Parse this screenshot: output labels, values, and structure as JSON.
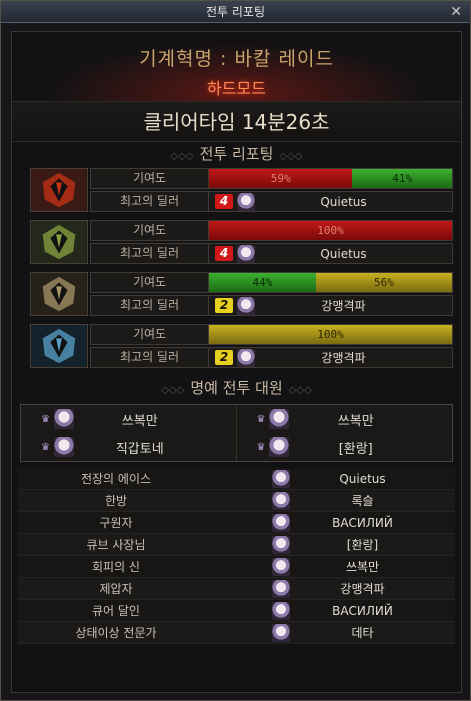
{
  "window": {
    "title": "전투 리포팅",
    "close_icon": "close-icon"
  },
  "header": {
    "dungeon": "기계혁명 : 바칼 레이드",
    "difficulty": "하드모드"
  },
  "clear_time": "클리어타임 14분26초",
  "battle_report": {
    "title": "전투 리포팅",
    "contribution_label": "기여도",
    "top_dealer_label": "최고의 딜러",
    "rows": [
      {
        "boss_icon": "red-boss-icon",
        "segments": [
          {
            "label": "59%",
            "value": 59,
            "color": "red"
          },
          {
            "label": "41%",
            "value": 41,
            "color": "green"
          }
        ],
        "party_number": "4",
        "party_color": "red",
        "dealer": "Quietus"
      },
      {
        "boss_icon": "green-boss-icon",
        "segments": [
          {
            "label": "100%",
            "value": 100,
            "color": "red"
          }
        ],
        "party_number": "4",
        "party_color": "red",
        "dealer": "Quietus"
      },
      {
        "boss_icon": "gold-boss-icon",
        "segments": [
          {
            "label": "44%",
            "value": 44,
            "color": "green"
          },
          {
            "label": "56%",
            "value": 56,
            "color": "yellow"
          }
        ],
        "party_number": "2",
        "party_color": "yellow",
        "dealer": "강맹격파"
      },
      {
        "boss_icon": "blue-boss-icon",
        "segments": [
          {
            "label": "100%",
            "value": 100,
            "color": "yellow"
          }
        ],
        "party_number": "2",
        "party_color": "yellow",
        "dealer": "강맹격파"
      }
    ]
  },
  "honor": {
    "title": "명예 전투 대원",
    "members": [
      "쓰복만",
      "쓰복만",
      "직갑토네",
      "[환랑]"
    ]
  },
  "titles": [
    {
      "title": "전장의 에이스",
      "player": "Quietus"
    },
    {
      "title": "한방",
      "player": "록슬"
    },
    {
      "title": "구원자",
      "player": "ВАСИЛИЙ"
    },
    {
      "title": "큐브 사장님",
      "player": "[환랑]"
    },
    {
      "title": "회피의 신",
      "player": "쓰복만"
    },
    {
      "title": "제압자",
      "player": "강맹격파"
    },
    {
      "title": "큐어 달인",
      "player": "ВАСИЛИЙ"
    },
    {
      "title": "상태이상 전문가",
      "player": "데타"
    }
  ]
}
